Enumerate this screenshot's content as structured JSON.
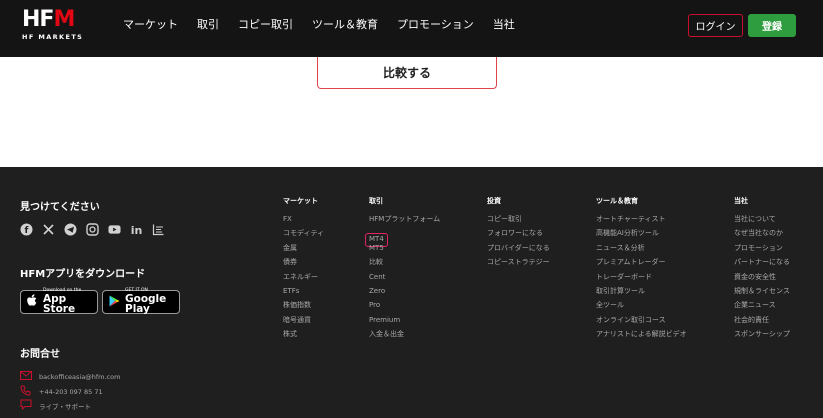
{
  "header": {
    "logo_text": "HFM",
    "logo_sub": "HF MARKETS",
    "nav": [
      "マーケット",
      "取引",
      "コピー取引",
      "ツール＆教育",
      "プロモーション",
      "当社"
    ],
    "login": "ログイン",
    "register": "登録"
  },
  "main": {
    "compare": "比較する"
  },
  "footer": {
    "find_us": "見つけてください",
    "social_icons": [
      "facebook-icon",
      "x-icon",
      "telegram-icon",
      "instagram-icon",
      "youtube-icon",
      "linkedin-icon",
      "chart-icon"
    ],
    "app_heading": "HFMアプリをダウンロード",
    "app_store": {
      "small": "Download on the",
      "big": "App Store"
    },
    "google_play": {
      "small": "GET IT ON",
      "big": "Google Play"
    },
    "contact_heading": "お問合せ",
    "contacts": [
      {
        "icon": "mail-icon",
        "text": "backofficeasia@hfm.com"
      },
      {
        "icon": "phone-icon",
        "text": "+44-203 097 85 71"
      },
      {
        "icon": "chat-icon",
        "text": "ライブ・サポート"
      }
    ],
    "columns": [
      {
        "title": "マーケット",
        "items": [
          "FX",
          "コモディティ",
          "金属",
          "債券",
          "エネルギー",
          "ETFs",
          "株価指数",
          "暗号通貨",
          "株式"
        ]
      },
      {
        "title": "取引",
        "items": [
          "HFMプラットフォーム",
          "MT4",
          "MT5",
          "比較",
          "Cent",
          "Zero",
          "Pro",
          "Premium",
          "入金＆出金"
        ]
      },
      {
        "title": "投資",
        "items": [
          "コピー取引",
          "フォロワーになる",
          "プロバイダーになる",
          "コピーストラテジー"
        ]
      },
      {
        "title": "ツール＆教育",
        "items": [
          "オートチャーティスト",
          "高機能AI分析ツール",
          "ニュース＆分析",
          "プレミアムトレーダー",
          "トレーダーボード",
          "取引計算ツール",
          "全ツール",
          "オンライン取引コース",
          "アナリストによる解説ビデオ"
        ]
      },
      {
        "title": "当社",
        "items": [
          "当社について",
          "なぜ当社なのか",
          "プロモーション",
          "パートナーになる",
          "資金の安全性",
          "規制＆ライセンス",
          "企業ニュース",
          "社会的責任",
          "スポンサーシップ"
        ]
      }
    ]
  },
  "colors": {
    "accent": "#c8102e",
    "register": "#2e9d3f",
    "footer_bg": "#1f1f1f",
    "header_bg": "#141414"
  }
}
